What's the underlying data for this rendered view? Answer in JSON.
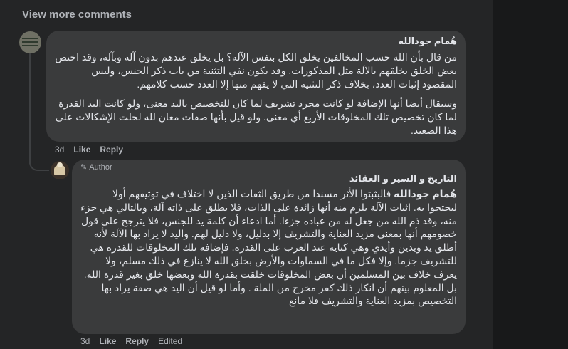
{
  "view_more_label": "View more comments",
  "comments": [
    {
      "author": "هُمام جودالله",
      "paragraphs": [
        "من قال بأن الله حسب المخالفين يخلق الكل بنفس الآلة؟ بل يخلق عندهم بدون آلة وبآلة، وقد اختص بعض الخلق بخلقهم بالآلة مثل المذكورات. وقد يكون نفي التثنية من باب ذكر الجنس، وليس المقصود إثبات العدد، بخلاف ذكر التثنية التي لا يفهم منها إلا العدد حسب كلامهم.",
        "وسيقال أيضا أنها الإضافة لو كانت مجرد تشريف لما كان للتخصيص باليد معنى، ولو كانت اليد القدرة لما كان تخصيص تلك المخلوقات الأربع أي معنى. ولو قيل بأنها صفات معان لله لحلت الإشكالات على هذا الصعيد."
      ],
      "time": "3d",
      "like_label": "Like",
      "reply_label": "Reply"
    },
    {
      "badge": "Author",
      "author": "التاريخ و السير و العقائد",
      "mention": "هُمام جودالله",
      "body": "فالبثبتوا الأثر مسندا من طريق الثقات الذين لا اختلاف في توثيقهم أولا ليحتجوا به. اثبات الآلة يلزم منه أنها زائدة على الذات، فلا يطلق على ذاته آلة، وبالتالي هي جزء منه، وقد ذم الله من جعل له من عباده جزءا. أما ادعاء أن كلمة يد للجنس، فلا يترجح على قول خصومهم أنها بمعنى مزيد العناية والتشريف إلا بدليل، ولا دليل لهم. واليد لا يراد بها الآلة لأنه أطلق يد ويدين وأيدي وهي كناية عند العرب على القدرة. فإضافة تلك المخلوقات للقدرة هي للتشريف جزما. وإلا فكل ما في السماوات والأرض بخلق الله لا ينازع في ذلك مسلم، ولا يعرف خلاف بين المسلمين أن بعض المخلوقات خلقت بقدرة الله وبعضها خلق بغير قدرة الله. بل المعلوم بينهم أن انكار ذلك كفر مخرج من الملة . وأما لو قيل أن اليد هي صفة يراد بها التخصيص بمزيد العناية والتشريف فلا مانع",
      "time": "3d",
      "like_label": "Like",
      "reply_label": "Reply",
      "edited_label": "Edited"
    }
  ],
  "icons": {
    "badge_icon": "pencil-icon"
  },
  "colors": {
    "background": "#242526",
    "bubble": "#3a3b3c",
    "text": "#e4e6eb",
    "muted": "#b0b3b8"
  }
}
